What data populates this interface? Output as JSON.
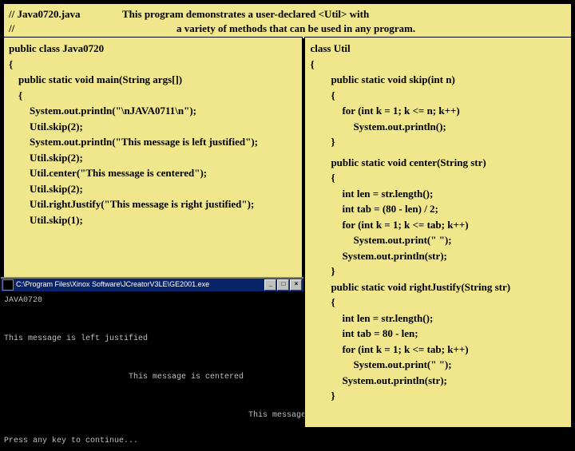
{
  "header": {
    "file": "// Java0720.java",
    "desc1": "This program demonstrates a user-declared <Util> with",
    "file2": "//",
    "desc2": "a variety of methods that can be used in any program."
  },
  "left": {
    "l0": "public class Java0720",
    "l1": "{",
    "l2": "public static void main(String args[])",
    "l3": "{",
    "l4": "System.out.println(\"\\nJAVA0711\\n\");",
    "l5": "Util.skip(2);",
    "l6": "System.out.println(\"This message is left justified\");",
    "l7": "Util.skip(2);",
    "l8": "Util.center(\"This message is centered\");",
    "l9": "Util.skip(2);",
    "l10": "Util.rightJustify(\"This message is right justified\");",
    "l11": "Util.skip(1);"
  },
  "right": {
    "r0": "class Util",
    "r1": "{",
    "r2": "public static void skip(int n)",
    "r3": "{",
    "r4": "for (int k = 1; k <= n; k++)",
    "r5": "System.out.println();",
    "r6": "}",
    "r7": "public static void center(String str)",
    "r8": "{",
    "r9": "int len = str.length();",
    "r10": "int tab = (80 - len) / 2;",
    "r11": "for (int k = 1; k <= tab; k++)",
    "r12": "System.out.print(\" \");",
    "r13": "System.out.println(str);",
    "r14": "}",
    "r15": "public static void rightJustify(String str)",
    "r16": "{",
    "r17": "int len = str.length();",
    "r18": "int tab = 80 - len;",
    "r19": "for (int k = 1; k <= tab; k++)",
    "r20": "System.out.print(\" \");",
    "r21": "System.out.println(str);",
    "r22": "}"
  },
  "console": {
    "title": "C:\\Program Files\\Xinox Software\\JCreatorV3LE\\GE2001.exe",
    "line1": "JAVA0720",
    "line2": "This message is left justified",
    "line3": "                          This message is centered",
    "line4": "                                                   This message is right justified",
    "line5": "Press any key to continue..."
  }
}
